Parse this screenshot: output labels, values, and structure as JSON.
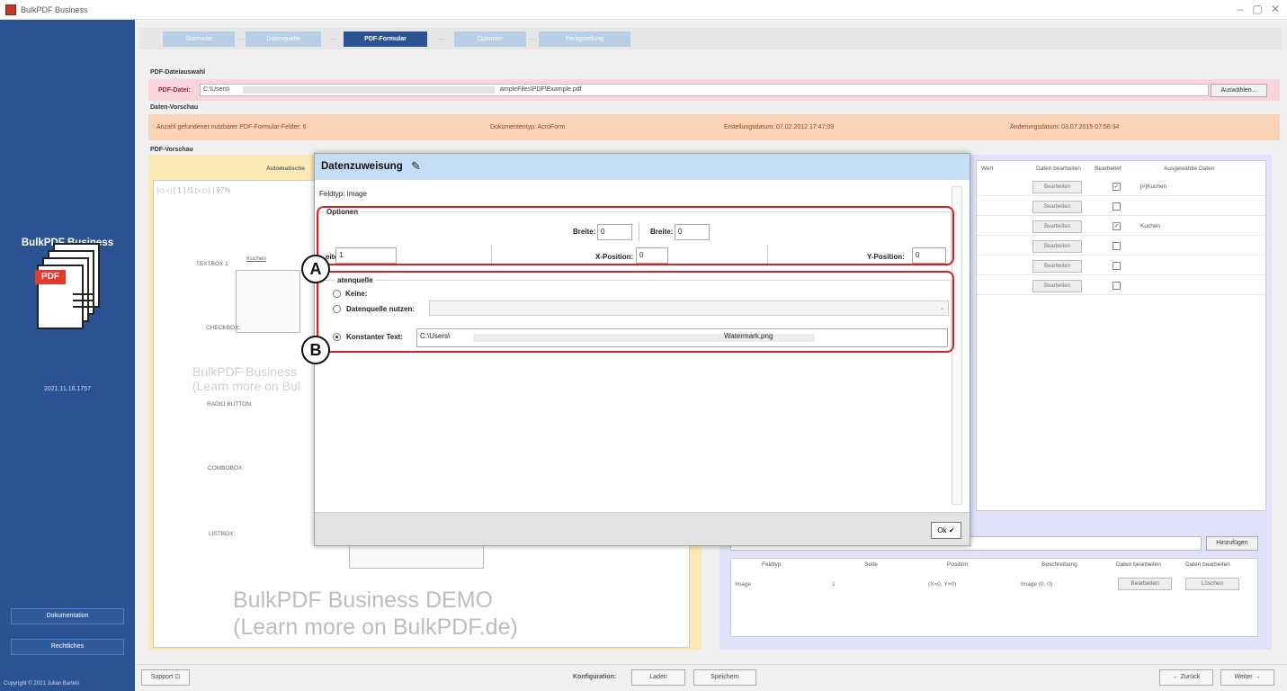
{
  "window": {
    "title": "BulkPDF Business",
    "controls": [
      "–",
      "▢",
      "✕"
    ]
  },
  "sidebar": {
    "brand": "BulkPDF Business",
    "doc_icon_label": "PDF",
    "version": "2021.11.16.1757",
    "docs_label": "Dokumentation",
    "legal_label": "Rechtliches",
    "copyright": "Copyright © 2021 Julian Bartels"
  },
  "steps": [
    {
      "label": "Startseite"
    },
    {
      "label": "Datenquelle"
    },
    {
      "label": "PDF-Formular"
    },
    {
      "label": "Optionen"
    },
    {
      "label": "Fertigstellung"
    }
  ],
  "file_select": {
    "section_title": "PDF-Dateiauswahl",
    "label": "PDF-Datei:",
    "path_prefix": "C:\\Users\\",
    "path_suffix": "ampleFiles\\PDF\\Example.pdf",
    "choose_button": "Auswählen..."
  },
  "data_preview": {
    "section_title": "Daten-Vorschau",
    "field_count": "Anzahl gefundener nutzbarer PDF-Formular-Felder:  6",
    "doctype": "Dokumententyp:  AcroForm",
    "created": "Erstellungsdatum:  07.02.2012 17:47:09",
    "modified": "Änderungsdatum:  03.07.2015 07:56:34"
  },
  "pdf_preview": {
    "section_title": "PDF-Vorschau",
    "auto_label": "Automatische",
    "toolbar_text": "|◁  ◁  [ 1 ] /1  ▷  ▷|  |  97%",
    "fields": [
      "TEXTBOX 1:",
      "CHECKBOX:",
      "RADIO BUTTON:",
      "COMBOBOX:",
      "LISTBOX:"
    ],
    "textbox_value": "Kuchen",
    "watermark_small_1": "BulkPDF Business",
    "watermark_small_2": "(Learn more on Bul",
    "watermark_big_1": "BulkPDF Business DEMO",
    "watermark_big_2": "(Learn more on BulkPDF.de)"
  },
  "field_grid": {
    "col_value": "Wert",
    "col_edit": "Daten bearbeiten",
    "col_edited": "Bearbeitet",
    "col_selected": "Ausgewählte Daten",
    "edit_label": "Bearbeiten",
    "rows": [
      {
        "checked": true,
        "value": "[#]Kuchen"
      },
      {
        "checked": false,
        "value": ""
      },
      {
        "checked": true,
        "value": "Kuchen"
      },
      {
        "checked": false,
        "value": ""
      },
      {
        "checked": false,
        "value": ""
      },
      {
        "checked": false,
        "value": ""
      }
    ]
  },
  "lower_table": {
    "add_button": "Hinzufügen",
    "headers": [
      "Feldtyp",
      "Seite",
      "Position",
      "Beschreibung",
      "Daten bearbeiten",
      "Daten bearbeiten"
    ],
    "row": {
      "type": "Image",
      "page": "1",
      "position": "(X=0, Y=0)",
      "description": "Image (0, 0)",
      "edit": "Bearbeiten",
      "delete": "Löschen"
    }
  },
  "bottom": {
    "support": "Support ⊡",
    "konfig_label": "Konfiguration:",
    "load": "Laden",
    "save": "Speichern",
    "back": "← Zurück",
    "next": "Weiter →"
  },
  "dialog": {
    "title": "Datenzuweisung",
    "fieldtype": "Feldtyp: Image",
    "options_title": "Optionen",
    "width_label_1": "Breite:",
    "width_value_1": "0",
    "width_label_2": "Breite:",
    "width_value_2": "0",
    "page_label": "eite:",
    "page_value": "1",
    "xpos_label": "X-Position:",
    "xpos_value": "0",
    "ypos_label": "Y-Position:",
    "ypos_value": "0",
    "source_title": "atenquelle",
    "opt_none": "Keine:",
    "opt_source": "Datenquelle nutzen:",
    "opt_const": "Konstanter Text:",
    "const_prefix": "C:\\Users\\",
    "const_suffix": "Watermark.png",
    "ok": "Ok ✔"
  },
  "callouts": {
    "a": "A",
    "b": "B"
  },
  "colors": {
    "sidebar": "#2b5394",
    "accent": "#2b5394",
    "highlight": "#d8202a",
    "pink": "#f9d4dc",
    "orange": "#fad3b6",
    "yellow": "#fbe9b5",
    "purple": "#e1e1fb"
  }
}
